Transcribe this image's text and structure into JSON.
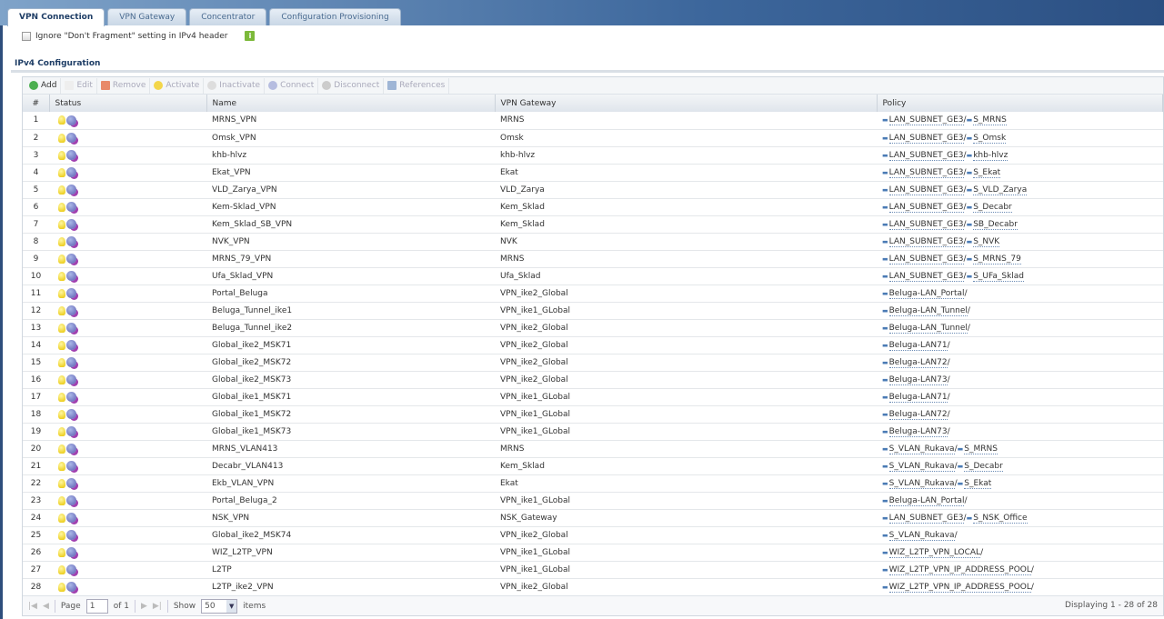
{
  "tabs": [
    "VPN Connection",
    "VPN Gateway",
    "Concentrator",
    "Configuration Provisioning"
  ],
  "frag_label": "Ignore \"Don't Fragment\" setting in IPv4 header",
  "section_title": "IPv4 Configuration",
  "toolbar": {
    "add": "Add",
    "edit": "Edit",
    "remove": "Remove",
    "activate": "Activate",
    "inactivate": "Inactivate",
    "connect": "Connect",
    "disconnect": "Disconnect",
    "references": "References"
  },
  "columns": [
    "#",
    "Status",
    "Name",
    "VPN Gateway",
    "Policy"
  ],
  "rows": [
    {
      "n": "1",
      "name": "MRNS_VPN",
      "gw": "MRNS",
      "p1": "LAN_SUBNET_GE3",
      "p2": "S_MRNS"
    },
    {
      "n": "2",
      "name": "Omsk_VPN",
      "gw": "Omsk",
      "p1": "LAN_SUBNET_GE3",
      "p2": "S_Omsk"
    },
    {
      "n": "3",
      "name": "khb-hlvz",
      "gw": "khb-hlvz",
      "p1": "LAN_SUBNET_GE3",
      "p2": "khb-hlvz"
    },
    {
      "n": "4",
      "name": "Ekat_VPN",
      "gw": "Ekat",
      "p1": "LAN_SUBNET_GE3",
      "p2": "S_Ekat"
    },
    {
      "n": "5",
      "name": "VLD_Zarya_VPN",
      "gw": "VLD_Zarya",
      "p1": "LAN_SUBNET_GE3",
      "p2": "S_VLD_Zarya"
    },
    {
      "n": "6",
      "name": "Kem-Sklad_VPN",
      "gw": "Kem_Sklad",
      "p1": "LAN_SUBNET_GE3",
      "p2": "S_Decabr"
    },
    {
      "n": "7",
      "name": "Kem_Sklad_SB_VPN",
      "gw": "Kem_Sklad",
      "p1": "LAN_SUBNET_GE3",
      "p2": "SB_Decabr"
    },
    {
      "n": "8",
      "name": "NVK_VPN",
      "gw": "NVK",
      "p1": "LAN_SUBNET_GE3",
      "p2": "S_NVK"
    },
    {
      "n": "9",
      "name": "MRNS_79_VPN",
      "gw": "MRNS",
      "p1": "LAN_SUBNET_GE3",
      "p2": "S_MRNS_79"
    },
    {
      "n": "10",
      "name": "Ufa_Sklad_VPN",
      "gw": "Ufa_Sklad",
      "p1": "LAN_SUBNET_GE3",
      "p2": "S_UFa_Sklad"
    },
    {
      "n": "11",
      "name": "Portal_Beluga",
      "gw": "VPN_ike2_Global",
      "p1": "Beluga-LAN_Portal",
      "p2": ""
    },
    {
      "n": "12",
      "name": "Beluga_Tunnel_ike1",
      "gw": "VPN_ike1_GLobal",
      "p1": "Beluga-LAN_Tunnel",
      "p2": ""
    },
    {
      "n": "13",
      "name": "Beluga_Tunnel_ike2",
      "gw": "VPN_ike2_Global",
      "p1": "Beluga-LAN_Tunnel",
      "p2": ""
    },
    {
      "n": "14",
      "name": "Global_ike2_MSK71",
      "gw": "VPN_ike2_Global",
      "p1": "Beluga-LAN71",
      "p2": ""
    },
    {
      "n": "15",
      "name": "Global_ike2_MSK72",
      "gw": "VPN_ike2_Global",
      "p1": "Beluga-LAN72",
      "p2": ""
    },
    {
      "n": "16",
      "name": "Global_ike2_MSK73",
      "gw": "VPN_ike2_Global",
      "p1": "Beluga-LAN73",
      "p2": ""
    },
    {
      "n": "17",
      "name": "Global_ike1_MSK71",
      "gw": "VPN_ike1_GLobal",
      "p1": "Beluga-LAN71",
      "p2": ""
    },
    {
      "n": "18",
      "name": "Global_ike1_MSK72",
      "gw": "VPN_ike1_GLobal",
      "p1": "Beluga-LAN72",
      "p2": ""
    },
    {
      "n": "19",
      "name": "Global_ike1_MSK73",
      "gw": "VPN_ike1_GLobal",
      "p1": "Beluga-LAN73",
      "p2": ""
    },
    {
      "n": "20",
      "name": "MRNS_VLAN413",
      "gw": "MRNS",
      "p1": "S_VLAN_Rukava",
      "p2": "S_MRNS"
    },
    {
      "n": "21",
      "name": "Decabr_VLAN413",
      "gw": "Kem_Sklad",
      "p1": "S_VLAN_Rukava",
      "p2": "S_Decabr"
    },
    {
      "n": "22",
      "name": "Ekb_VLAN_VPN",
      "gw": "Ekat",
      "p1": "S_VLAN_Rukava",
      "p2": "S_Ekat"
    },
    {
      "n": "23",
      "name": "Portal_Beluga_2",
      "gw": "VPN_ike1_GLobal",
      "p1": "Beluga-LAN_Portal",
      "p2": ""
    },
    {
      "n": "24",
      "name": "NSK_VPN",
      "gw": "NSK_Gateway",
      "p1": "LAN_SUBNET_GE3",
      "p2": "S_NSK_Office"
    },
    {
      "n": "25",
      "name": "Global_ike2_MSK74",
      "gw": "VPN_ike2_Global",
      "p1": "S_VLAN_Rukava",
      "p2": ""
    },
    {
      "n": "26",
      "name": "WIZ_L2TP_VPN",
      "gw": "VPN_ike1_GLobal",
      "p1": "WIZ_L2TP_VPN_LOCAL",
      "p2": ""
    },
    {
      "n": "27",
      "name": "L2TP",
      "gw": "VPN_ike1_GLobal",
      "p1": "WIZ_L2TP_VPN_IP_ADDRESS_POOL",
      "p2": ""
    },
    {
      "n": "28",
      "name": "L2TP_ike2_VPN",
      "gw": "VPN_ike2_Global",
      "p1": "WIZ_L2TP_VPN_IP_ADDRESS_POOL",
      "p2": ""
    }
  ],
  "footer": {
    "page_label": "Page",
    "page": "1",
    "of": "of 1",
    "show": "Show",
    "per_page": "50",
    "items": "items",
    "displaying": "Displaying 1 - 28 of 28"
  }
}
